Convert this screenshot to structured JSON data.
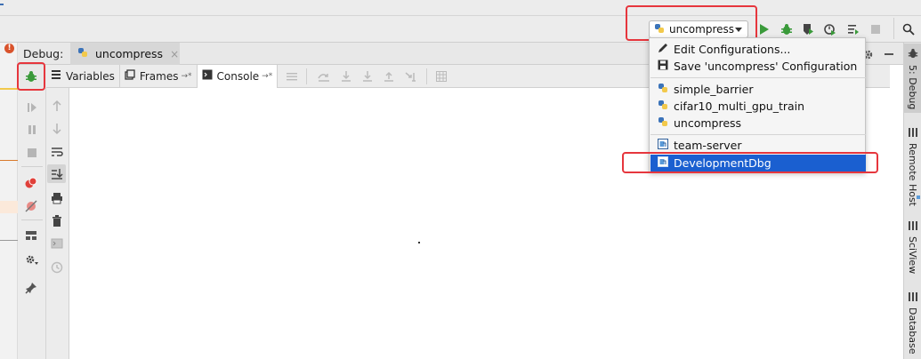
{
  "debug_panel": {
    "label": "Debug:",
    "tab": {
      "title": "uncompress",
      "close": "×"
    },
    "subtabs": [
      {
        "label": "Variables"
      },
      {
        "label": "Frames"
      },
      {
        "label": "Console",
        "active": true
      }
    ],
    "pin_glyph": "→*"
  },
  "toolbar": {
    "run_config": {
      "selected": "uncompress"
    }
  },
  "run_config_menu": {
    "actions": [
      {
        "label": "Edit Configurations...",
        "icon": "pencil-icon"
      },
      {
        "label": "Save 'uncompress' Configuration",
        "icon": "save-icon"
      }
    ],
    "python_configs": [
      {
        "label": "simple_barrier",
        "icon": "python-icon"
      },
      {
        "label": "cifar10_multi_gpu_train",
        "icon": "python-icon"
      },
      {
        "label": "uncompress",
        "icon": "python-icon"
      }
    ],
    "remote_configs": [
      {
        "label": "team-server",
        "icon": "remote-config-icon"
      },
      {
        "label": "DevelopmentDbg",
        "icon": "remote-config-icon",
        "selected": true
      }
    ]
  },
  "right_sidebar": {
    "items": [
      {
        "label": "5: Debug",
        "icon": "bug-icon",
        "active": true
      },
      {
        "label": "Remote Host",
        "icon": "remote-host-icon"
      },
      {
        "label": "SciView",
        "icon": "sciview-icon"
      },
      {
        "label": "Database",
        "icon": "database-icon"
      }
    ]
  },
  "colors": {
    "highlight": "#e6363d",
    "selection": "#1a5fd0",
    "run_green": "#3a9a3a",
    "panel_bg": "#ececec"
  }
}
